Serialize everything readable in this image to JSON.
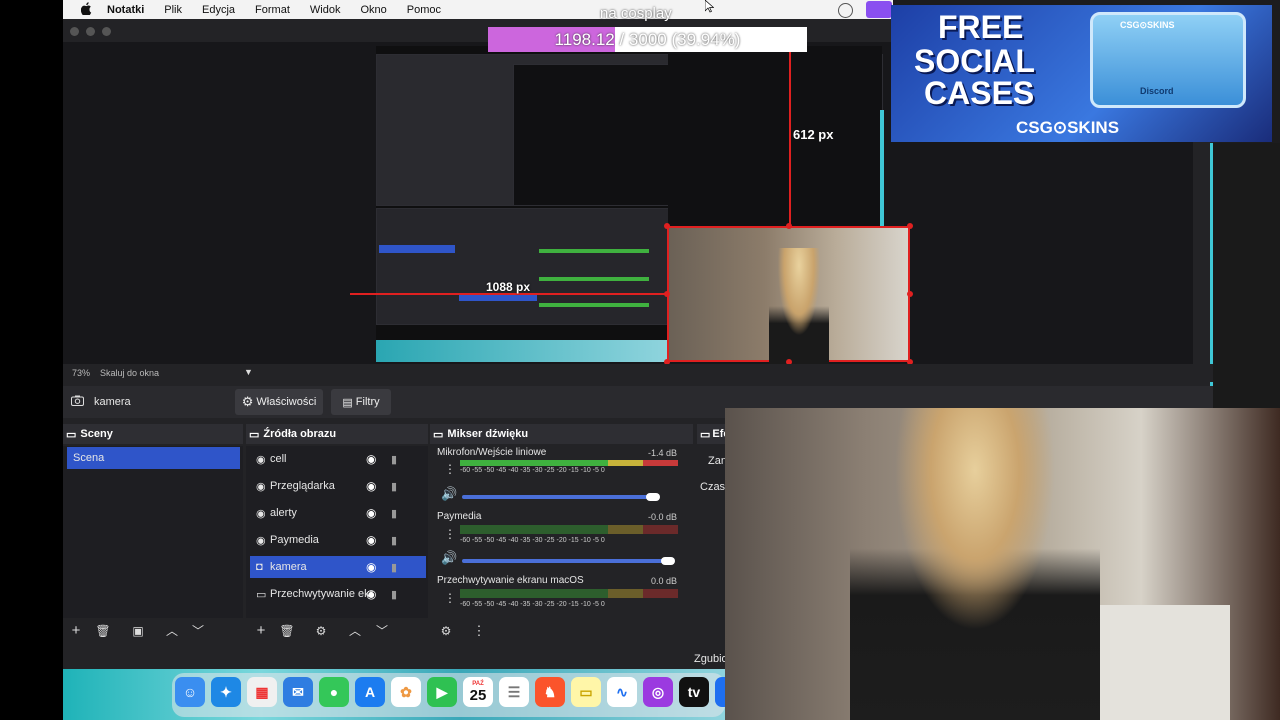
{
  "menubar": {
    "app": "Notatki",
    "items": [
      "Plik",
      "Edycja",
      "Format",
      "Widok",
      "Okno",
      "Pomoc"
    ]
  },
  "overlay": {
    "title": "na cosplay",
    "progress_text": "1198.12 / 3000 (39.94%)",
    "progress_fraction": 0.3994,
    "progress_color": "#cc66dd"
  },
  "preview": {
    "height_label": "612 px",
    "width_label": "1088 px"
  },
  "ad": {
    "line1": "FREE",
    "line2": "SOCIAL",
    "line3": "CASES",
    "brand": "CSG⊙SKINS",
    "box_top": "CSG⊙SKINS",
    "box_label": "Discord"
  },
  "zoom": {
    "level": "73%",
    "mode": "Skaluj do okna"
  },
  "source_bar": {
    "name": "kamera",
    "properties": "Właściwości",
    "filters": "Filtry"
  },
  "scenes": {
    "title": "Sceny",
    "items": [
      "Scena"
    ]
  },
  "sources": {
    "title": "Źródła obrazu",
    "items": [
      "cell",
      "Przeglądarka",
      "alerty",
      "Paymedia",
      "kamera",
      "Przechwytywanie ekr"
    ]
  },
  "mixer": {
    "title": "Mikser dźwięku",
    "scale": "-60 -55 -50 -45 -40 -35 -30 -25 -20 -15 -10 -5 0",
    "channels": [
      {
        "name": "Mikrofon/Wejście liniowe",
        "db": "-1.4 dB"
      },
      {
        "name": "Paymedia",
        "db": "-0.0 dB"
      },
      {
        "name": "Przechwytywanie ekranu macOS",
        "db": "0.0 dB"
      }
    ]
  },
  "effects": {
    "title": "Efe",
    "line1": "Zan",
    "line2": "Czas t"
  },
  "status": {
    "text": "Zgubio"
  },
  "dock": {
    "calendar_month": "PAŹ",
    "calendar_day": "25"
  }
}
